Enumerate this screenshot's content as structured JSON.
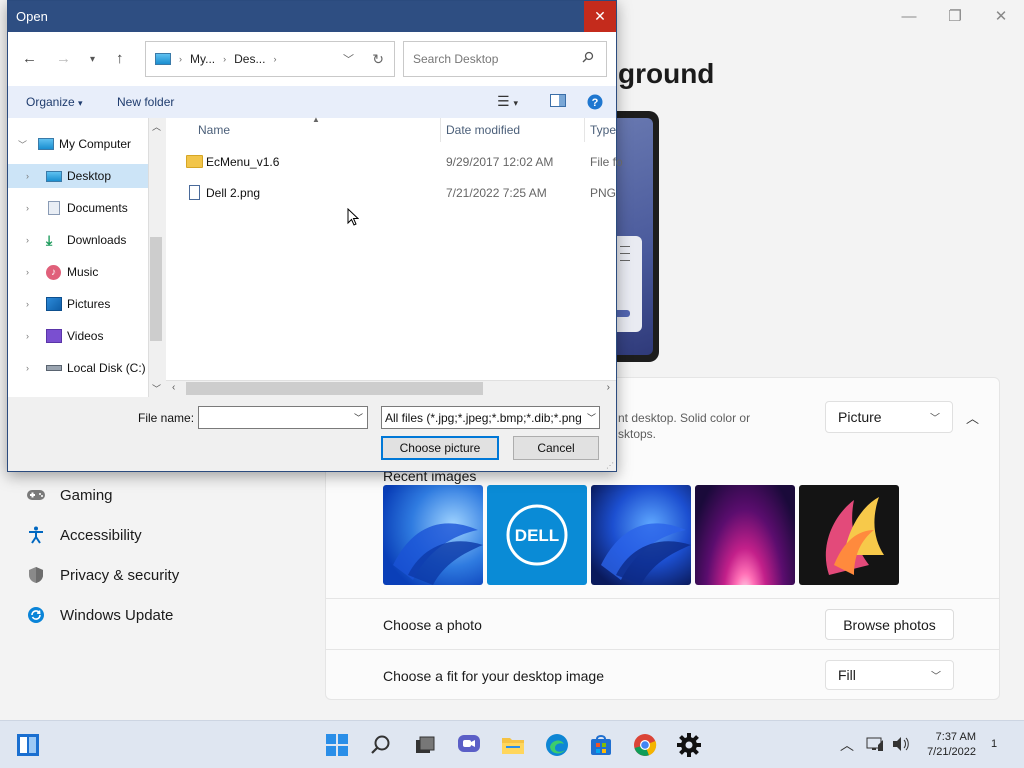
{
  "settings": {
    "title_fragment": "ground",
    "sidebar": [
      {
        "label": "Gaming",
        "icon": "gamepad-icon"
      },
      {
        "label": "Accessibility",
        "icon": "accessibility-icon"
      },
      {
        "label": "Privacy & security",
        "icon": "shield-icon"
      },
      {
        "label": "Windows Update",
        "icon": "windows-update-icon"
      }
    ],
    "background": {
      "desc_line1": "nt desktop. Solid color or",
      "desc_line2": "sktops.",
      "type_value": "Picture"
    },
    "recent_label": "Recent images",
    "choose_photo_label": "Choose a photo",
    "browse_label": "Browse photos",
    "fit_label": "Choose a fit for your desktop image",
    "fit_value": "Fill"
  },
  "dialog": {
    "title": "Open",
    "close": "✕",
    "breadcrumb": [
      "My...",
      "Des...",
      ""
    ],
    "search_placeholder": "Search Desktop",
    "toolbar": {
      "organize": "Organize",
      "new_folder": "New folder"
    },
    "tree": [
      {
        "label": "My Computer",
        "icon": "computer-icon",
        "level": 0,
        "expanded": true
      },
      {
        "label": "Desktop",
        "icon": "desktop-icon",
        "level": 1,
        "selected": true
      },
      {
        "label": "Documents",
        "icon": "documents-icon",
        "level": 1
      },
      {
        "label": "Downloads",
        "icon": "downloads-icon",
        "level": 1
      },
      {
        "label": "Music",
        "icon": "music-icon",
        "level": 1
      },
      {
        "label": "Pictures",
        "icon": "pictures-icon",
        "level": 1
      },
      {
        "label": "Videos",
        "icon": "videos-icon",
        "level": 1
      },
      {
        "label": "Local Disk (C:)",
        "icon": "disk-icon",
        "level": 1
      }
    ],
    "columns": {
      "name": "Name",
      "date": "Date modified",
      "type": "Type"
    },
    "files": [
      {
        "name": "EcMenu_v1.6",
        "date": "9/29/2017 12:02 AM",
        "type": "File fo",
        "icon": "folder-icon"
      },
      {
        "name": "Dell 2.png",
        "date": "7/21/2022 7:25 AM",
        "type": "PNG",
        "icon": "image-file-icon"
      }
    ],
    "file_name_label": "File name:",
    "file_name_value": "",
    "filter_value": "All files (*.jpg;*.jpeg;*.bmp;*.dib;*.png",
    "choose_button": "Choose picture",
    "cancel_button": "Cancel"
  },
  "taskbar": {
    "time": "7:37 AM",
    "date": "7/21/2022",
    "notifications": "1"
  },
  "colors": {
    "title_bar": "#2e4e82",
    "close": "#c42b1c",
    "selection": "#cce4f7",
    "accent": "#0078d7"
  }
}
